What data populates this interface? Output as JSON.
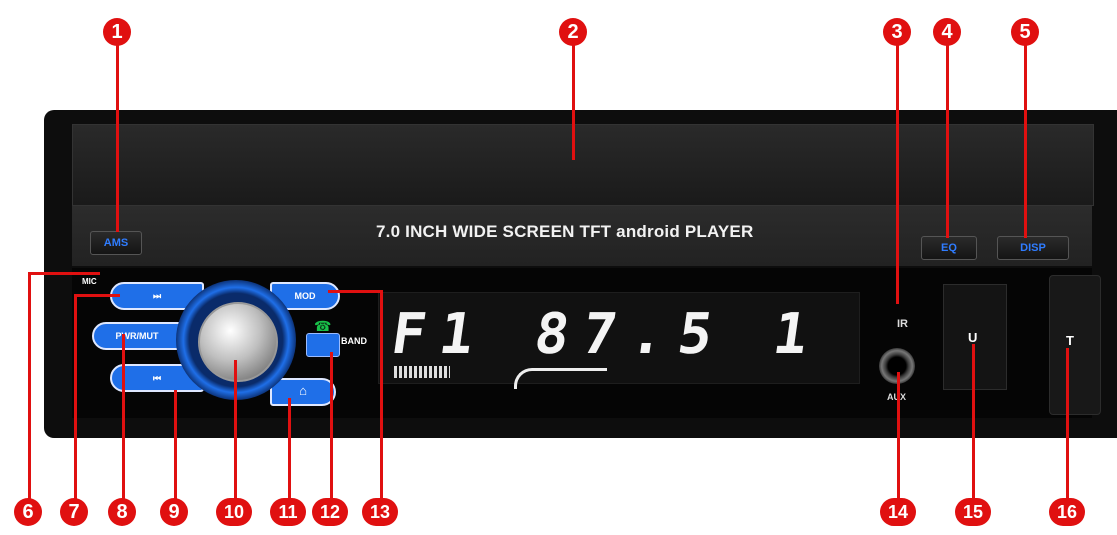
{
  "device": {
    "title": "7.0 INCH WIDE SCREEN TFT android PLAYER",
    "ams_label": "AMS",
    "eq_label": "EQ",
    "disp_label": "DISP",
    "mic_label": "MIC",
    "next_label": "⏭",
    "pwr_label": "PWR/MUT",
    "prev_label": "⏮",
    "home_label": "⌂",
    "mod_label": "MOD",
    "band_label": "BAND",
    "ir_label": "IR",
    "aux_label": "AUX",
    "usb_label": "U",
    "tf_label": "T",
    "lcd": "F1 87.5 1"
  },
  "callouts": [
    "1",
    "2",
    "3",
    "4",
    "5",
    "6",
    "7",
    "8",
    "9",
    "10",
    "11",
    "12",
    "13",
    "14",
    "15",
    "16"
  ],
  "colors": {
    "accent_blue": "#1f6fe8",
    "callout_red": "#e01010"
  }
}
